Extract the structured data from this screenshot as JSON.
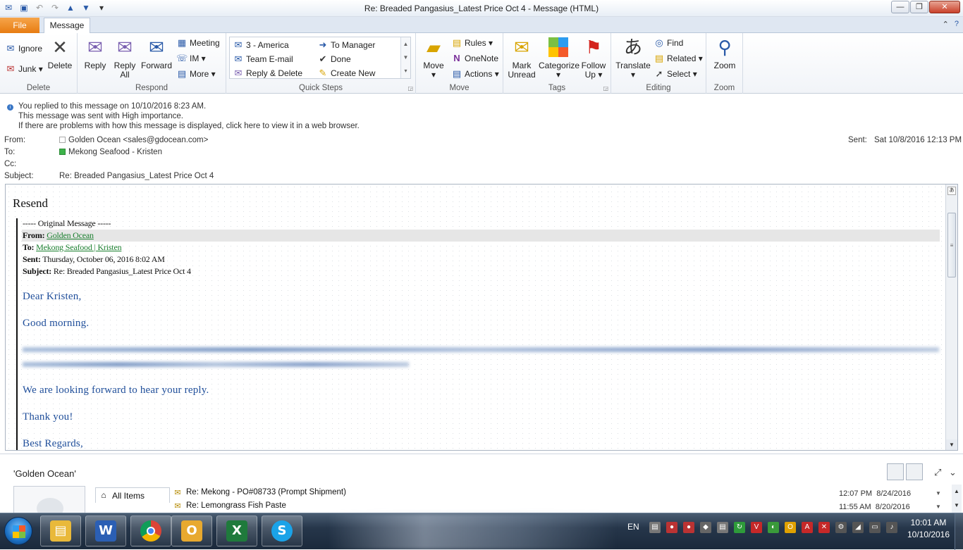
{
  "window": {
    "title": "Re: Breaded Pangasius_Latest Price Oct 4  -  Message (HTML)",
    "controls": [
      "minimize",
      "maximize",
      "close"
    ]
  },
  "tabs": {
    "file": "File",
    "message": "Message"
  },
  "ribbon": {
    "delete": {
      "label": "Delete",
      "ignore": "Ignore",
      "junk": "Junk",
      "delete_btn": "Delete"
    },
    "respond": {
      "label": "Respond",
      "reply": "Reply",
      "reply_all_1": "Reply",
      "reply_all_2": "All",
      "forward": "Forward",
      "meeting": "Meeting",
      "im": "IM",
      "more": "More"
    },
    "quick_steps": {
      "label": "Quick Steps",
      "items": [
        "3 - America",
        "To Manager",
        "Team E-mail",
        "Done",
        "Reply & Delete",
        "Create New"
      ]
    },
    "move": {
      "label": "Move",
      "move_btn": "Move",
      "rules": "Rules",
      "onenote": "OneNote",
      "actions": "Actions"
    },
    "tags": {
      "label": "Tags",
      "mark_1": "Mark",
      "mark_2": "Unread",
      "categorize": "Categorize",
      "follow_1": "Follow",
      "follow_2": "Up"
    },
    "editing": {
      "label": "Editing",
      "translate": "Translate",
      "find": "Find",
      "related": "Related",
      "select": "Select"
    },
    "zoom": {
      "label": "Zoom",
      "zoom_btn": "Zoom"
    }
  },
  "info": {
    "line1": "You replied to this message on 10/10/2016 8:23 AM.",
    "line2": "This message was sent with High importance.",
    "line3": "If there are problems with how this message is displayed, click here to view it in a web browser."
  },
  "header": {
    "from_label": "From:",
    "from_value": "Golden Ocean <sales@gdocean.com>",
    "to_label": "To:",
    "to_value": "Mekong Seafood - Kristen",
    "cc_label": "Cc:",
    "subject_label": "Subject:",
    "subject_value": "Re: Breaded Pangasius_Latest Price Oct 4",
    "sent_label": "Sent:",
    "sent_value": "Sat 10/8/2016 12:13 PM"
  },
  "body": {
    "resend": "Resend",
    "orig_sep": "----- Original Message -----",
    "from_key": "From",
    "from_link": "Golden Ocean",
    "to_key": "To",
    "to_link": "Mekong Seafood | Kristen",
    "sent_key": "Sent",
    "sent_value": "Thursday, October 06, 2016 8:02 AM",
    "subject_key": "Subject",
    "subject_value": "Re: Breaded Pangasius_Latest Price Oct 4",
    "greeting": "Dear Kristen,",
    "morning": "Good morning.",
    "forward_line": "We are looking forward to hear your reply.",
    "thanks": "Thank you!",
    "regards": "Best Regards,"
  },
  "people": {
    "name": "'Golden Ocean'",
    "nav_all": "All Items",
    "items": [
      {
        "subject": "Re: Mekong - PO#08733 (Prompt Shipment)",
        "time": "12:07 PM",
        "date": "8/24/2016"
      },
      {
        "subject": "Re: Lemongrass Fish Paste",
        "time": "11:55 AM",
        "date": "8/20/2016"
      }
    ]
  },
  "taskbar": {
    "lang": "EN",
    "time": "10:01 AM",
    "date": "10/10/2016",
    "apps": [
      "windows-explorer",
      "word",
      "chrome",
      "outlook",
      "excel",
      "skype"
    ]
  }
}
